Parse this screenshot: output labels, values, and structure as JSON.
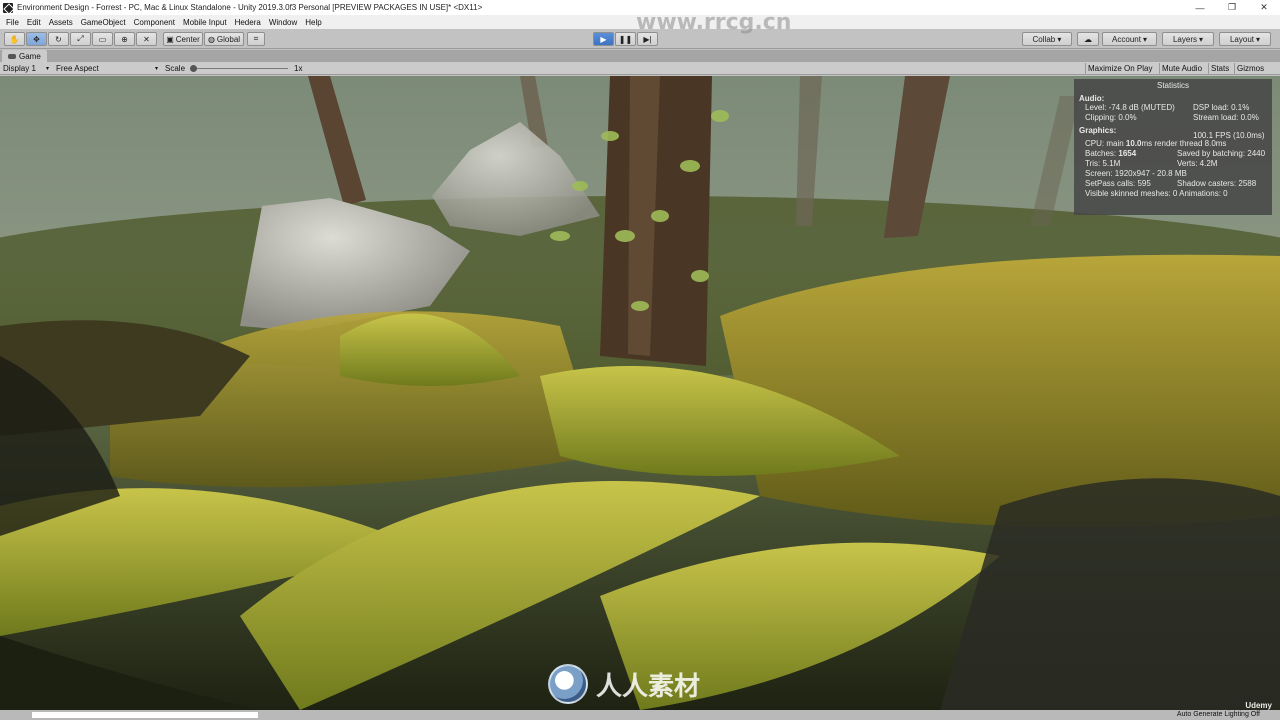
{
  "window": {
    "title": "Environment Design - Forrest - PC, Mac & Linux Standalone - Unity 2019.3.0f3 Personal [PREVIEW PACKAGES IN USE]* <DX11>",
    "controls": [
      "—",
      "❐",
      "✕"
    ]
  },
  "menu": [
    "File",
    "Edit",
    "Assets",
    "GameObject",
    "Component",
    "Mobile Input",
    "Hedera",
    "Window",
    "Help"
  ],
  "toolbar": {
    "pivot_label": "Center",
    "space_label": "Global",
    "collab_label": "Collab ▾",
    "account_label": "Account",
    "layers_label": "Layers",
    "layout_label": "Layout",
    "playing": true
  },
  "game_tab": {
    "label": "Game"
  },
  "game_bar": {
    "display": "Display 1",
    "aspect": "Free Aspect",
    "scale_label": "Scale",
    "scale_value": "1x",
    "maximize_on_play": "Maximize On Play",
    "mute_audio": "Mute Audio",
    "stats": "Stats",
    "gizmos": "Gizmos"
  },
  "statistics": {
    "title": "Statistics",
    "audio_header": "Audio:",
    "level": "Level: -74.8 dB (MUTED)",
    "clipping": "Clipping: 0.0%",
    "dsp_load": "DSP load: 0.1%",
    "stream_load": "Stream load: 0.0%",
    "graphics_header": "Graphics:",
    "fps": "100.1 FPS (10.0ms)",
    "cpu_main_label": "CPU: main",
    "cpu_main_value": "10.0",
    "cpu_main_unit": "ms  render thread 8.0ms",
    "batches_label": "Batches:",
    "batches_value": "1654",
    "saved_by_batching": "Saved by batching: 2440",
    "tris": "Tris: 5.1M",
    "verts": "Verts: 4.2M",
    "screen": "Screen: 1920x947 - 20.8 MB",
    "setpass": "SetPass calls: 595",
    "shadow_casters": "Shadow casters: 2588",
    "skinned_meshes": "Visible skinned meshes: 0  Animations: 0"
  },
  "status": {
    "lighting": "Auto Generate Lighting Off"
  },
  "watermarks": {
    "top": "www.rrcg.cn",
    "bottom": "人人素材",
    "udemy": "Udemy"
  }
}
